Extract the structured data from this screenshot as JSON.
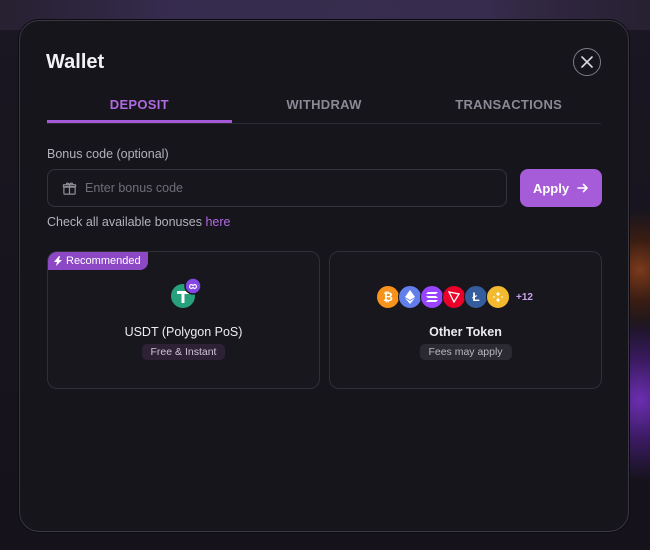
{
  "wallet": {
    "title": "Wallet",
    "tabs": [
      {
        "label": "DEPOSIT",
        "active": true
      },
      {
        "label": "WITHDRAW",
        "active": false
      },
      {
        "label": "TRANSACTIONS",
        "active": false
      }
    ],
    "bonus": {
      "label": "Bonus code (optional)",
      "placeholder": "Enter bonus code",
      "value": "",
      "apply_label": "Apply",
      "check_text": "Check all available bonuses ",
      "check_link": "here"
    },
    "options": [
      {
        "badge": "Recommended",
        "name": "USDT (Polygon PoS)",
        "tag": "Free & Instant"
      },
      {
        "name": "Other Token",
        "tag": "Fees may apply",
        "more_count": "+12"
      }
    ],
    "token_icons": [
      "bitcoin-icon",
      "ethereum-icon",
      "solana-icon",
      "tron-icon",
      "litecoin-icon",
      "bnb-icon"
    ],
    "colors": {
      "accent": "#a65bd8",
      "background": "#16151c"
    }
  }
}
